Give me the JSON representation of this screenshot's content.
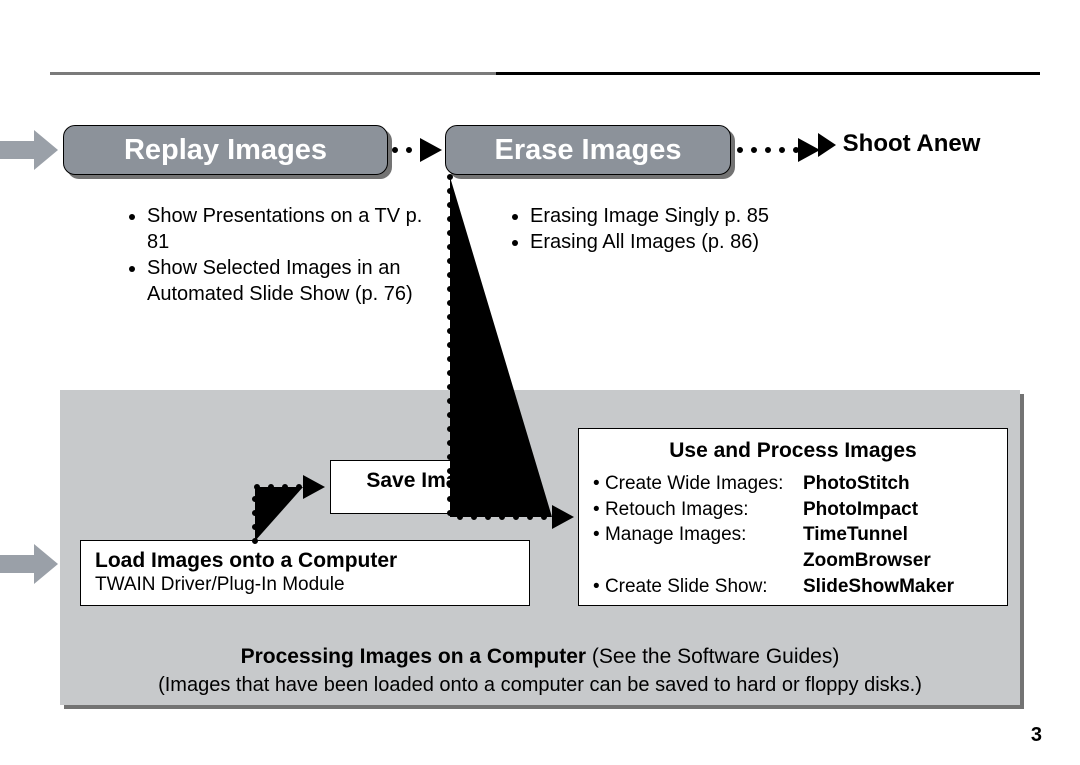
{
  "headers": {
    "replay": "Replay Images",
    "erase": "Erase Images",
    "shoot_anew": "Shoot Anew"
  },
  "replay_items": [
    "Show Presentations on a TV p. 81",
    "Show Selected Images in an Automated Slide Show (p. 76)"
  ],
  "erase_items": [
    "Erasing Image Singly p. 85",
    "Erasing All Images (p. 86)"
  ],
  "save": {
    "title": "Save Images"
  },
  "load": {
    "title": "Load Images onto a Computer",
    "subtitle": "TWAIN Driver/Plug-In Module"
  },
  "use": {
    "title": "Use and Process Images",
    "rows": [
      {
        "label": "Create Wide Images:",
        "value": "PhotoStitch"
      },
      {
        "label": "Retouch Images:",
        "value": "PhotoImpact"
      },
      {
        "label": "Manage Images:",
        "value": "TimeTunnel"
      },
      {
        "label": "",
        "value": "ZoomBrowser"
      },
      {
        "label": "Create Slide Show:",
        "value": "SlideShowMaker"
      }
    ]
  },
  "footer": {
    "line1_bold": "Processing Images on a Computer",
    "line1_rest": " (See the Software Guides)",
    "line2": "(Images that have been loaded onto a computer can be saved to hard or floppy disks.)"
  },
  "page_number": "3"
}
